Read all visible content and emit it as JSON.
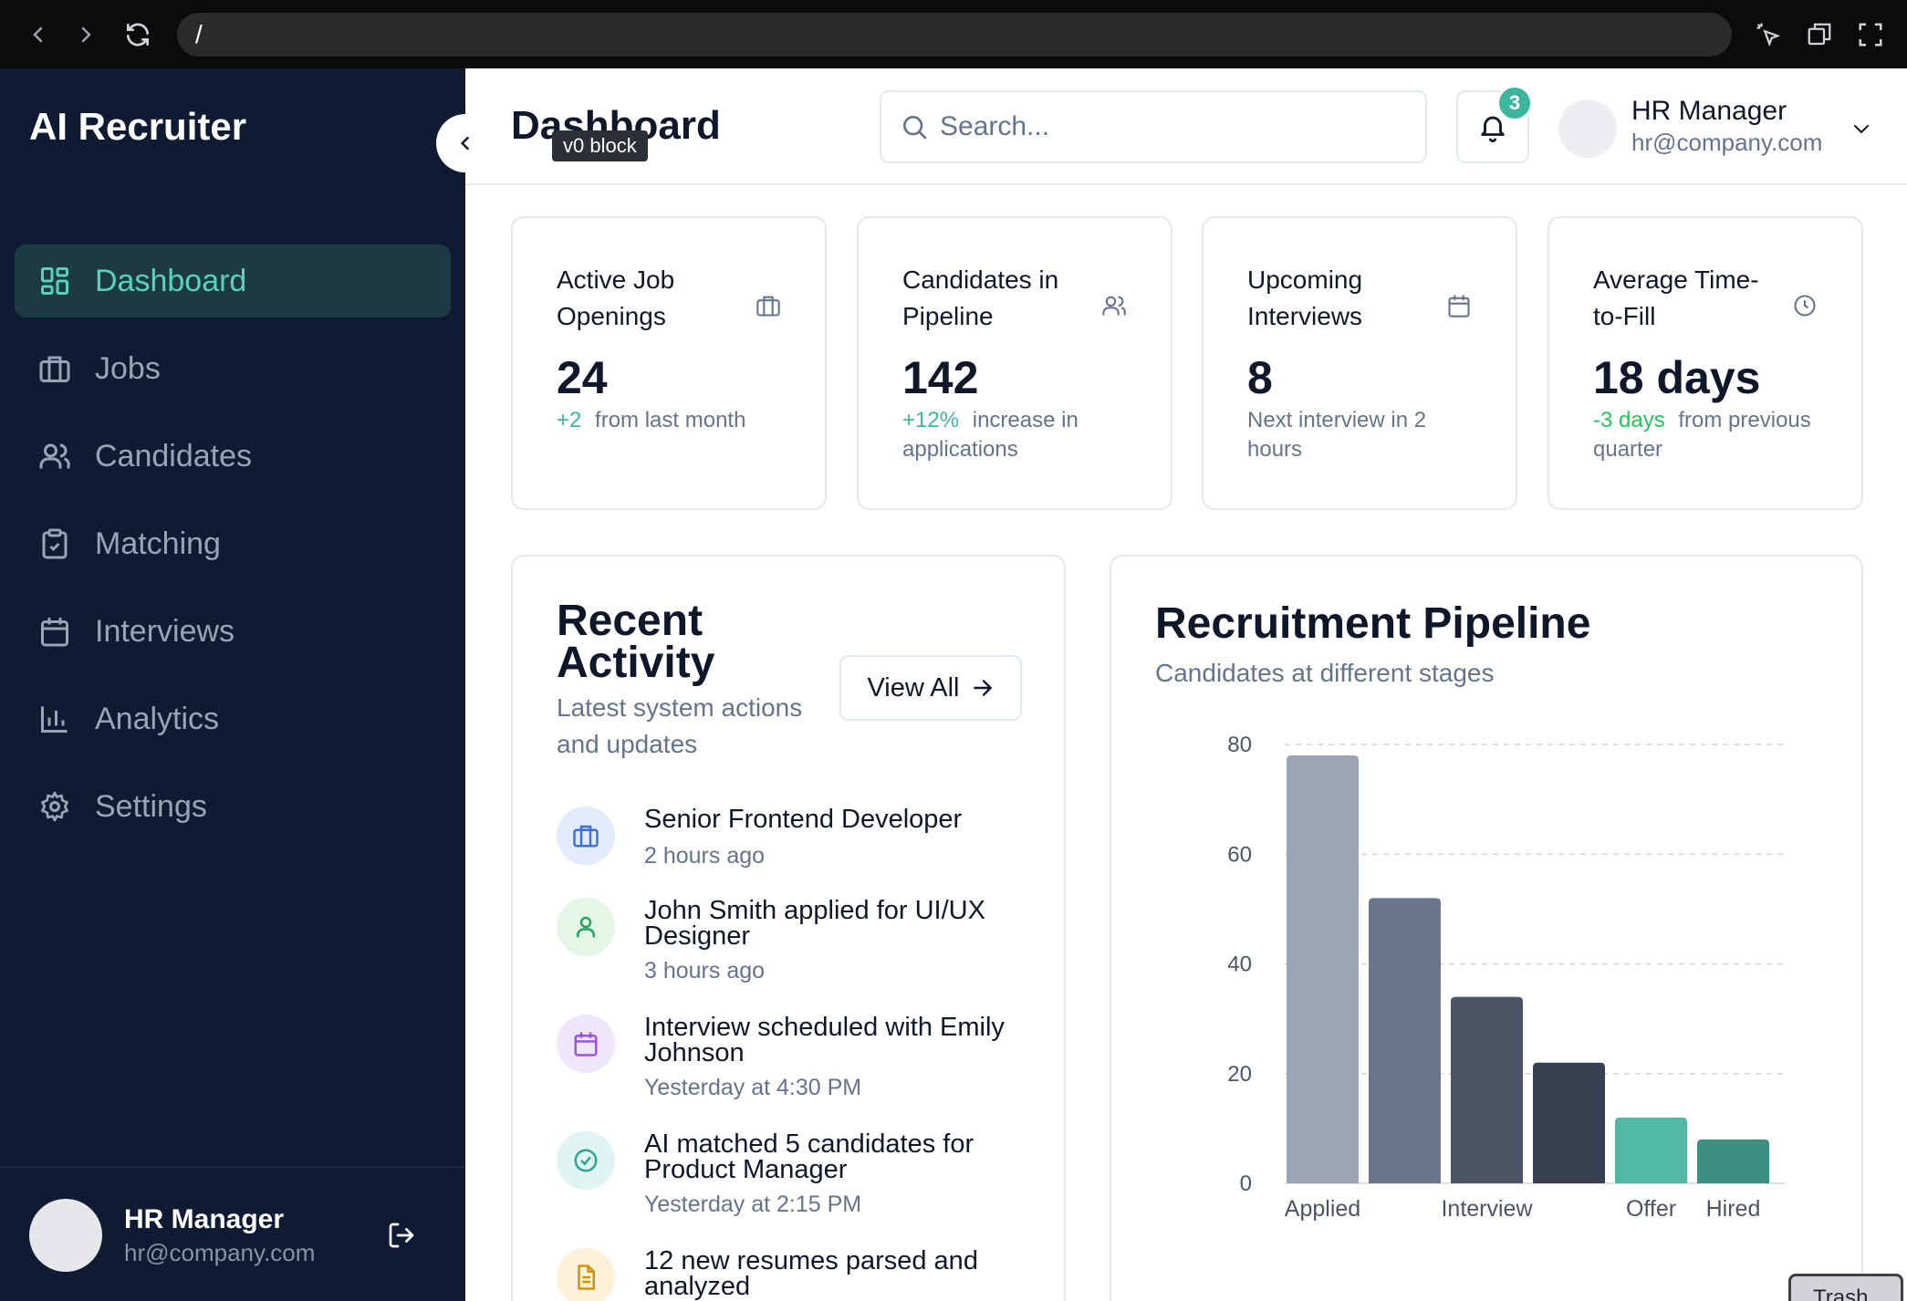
{
  "browser": {
    "url": "/"
  },
  "sidebar": {
    "brand": "AI Recruiter",
    "items": [
      {
        "label": "Dashboard",
        "icon": "dashboard-icon",
        "active": true
      },
      {
        "label": "Jobs",
        "icon": "briefcase-icon",
        "active": false
      },
      {
        "label": "Candidates",
        "icon": "users-icon",
        "active": false
      },
      {
        "label": "Matching",
        "icon": "clipboard-check-icon",
        "active": false
      },
      {
        "label": "Interviews",
        "icon": "calendar-icon",
        "active": false
      },
      {
        "label": "Analytics",
        "icon": "bar-chart-icon",
        "active": false
      },
      {
        "label": "Settings",
        "icon": "gear-icon",
        "active": false
      }
    ],
    "user": {
      "name": "HR Manager",
      "email": "hr@company.com"
    }
  },
  "header": {
    "title": "Dashboard",
    "tooltip": "v0 block",
    "search_placeholder": "Search...",
    "notification_count": "3",
    "user": {
      "name": "HR Manager",
      "email": "hr@company.com"
    }
  },
  "stats": [
    {
      "label": "Active Job Openings",
      "icon": "briefcase-icon",
      "value": "24",
      "delta": "+2",
      "note": "from last month"
    },
    {
      "label": "Candidates in Pipeline",
      "icon": "users-icon",
      "value": "142",
      "delta": "+12%",
      "note": "increase in applications"
    },
    {
      "label": "Upcoming Interviews",
      "icon": "calendar-icon",
      "value": "8",
      "delta": "",
      "note": "Next interview in 2 hours"
    },
    {
      "label": "Average Time-to-Fill",
      "icon": "clock-icon",
      "value": "18 days",
      "delta": "-3 days",
      "note": "from previous quarter"
    }
  ],
  "activity": {
    "title": "Recent Activity",
    "subtitle": "Latest system actions and updates",
    "view_all": "View All",
    "items": [
      {
        "text": "Senior Frontend Developer",
        "time": "2 hours ago",
        "icon": "briefcase-icon"
      },
      {
        "text": "John Smith applied for UI/UX Designer",
        "time": "3 hours ago",
        "icon": "user-icon"
      },
      {
        "text": "Interview scheduled with Emily Johnson",
        "time": "Yesterday at 4:30 PM",
        "icon": "calendar-icon"
      },
      {
        "text": "AI matched 5 candidates for Product Manager",
        "time": "Yesterday at 2:15 PM",
        "icon": "check-circle-icon"
      },
      {
        "text": "12 new resumes parsed and analyzed",
        "time": "",
        "icon": "document-icon"
      }
    ]
  },
  "pipeline": {
    "title": "Recruitment Pipeline",
    "subtitle": "Candidates at different stages"
  },
  "chart_data": {
    "type": "bar",
    "title": "Recruitment Pipeline",
    "subtitle": "Candidates at different stages",
    "categories": [
      "Applied",
      "",
      "Interview",
      "",
      "Offer",
      "Hired"
    ],
    "values": [
      78,
      52,
      34,
      22,
      12,
      8
    ],
    "colors": [
      "#9aa4b5",
      "#6b768c",
      "#4b5567",
      "#374151",
      "#52b8a3",
      "#3d8f82"
    ],
    "y_ticks": [
      0,
      20,
      40,
      60,
      80
    ],
    "ylim": [
      0,
      80
    ],
    "grid": true,
    "grid_style": "dashed"
  },
  "trash_label": "Trash"
}
